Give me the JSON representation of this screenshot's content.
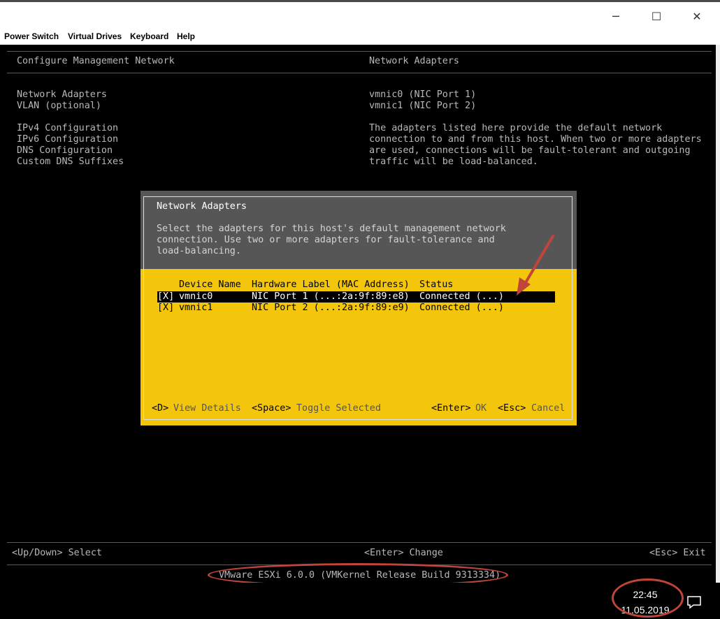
{
  "window": {
    "minimize_icon": "─",
    "maximize_icon": "☐",
    "close_icon": "✕"
  },
  "menu": {
    "items": [
      "Power Switch",
      "Virtual Drives",
      "Keyboard",
      "Help"
    ]
  },
  "console": {
    "left_title": "Configure Management Network",
    "right_title": "Network Adapters",
    "left_menu": [
      "Network Adapters",
      "VLAN (optional)",
      "IPv4 Configuration",
      "IPv6 Configuration",
      "DNS Configuration",
      "Custom DNS Suffixes"
    ],
    "right_adapters": [
      "vmnic0 (NIC Port 1)",
      "vmnic1 (NIC Port 2)"
    ],
    "right_description": [
      "The adapters listed here provide the default network",
      "connection to and from this host. When two or more adapters",
      "are used, connections will be fault-tolerant and outgoing",
      "traffic will be load-balanced."
    ],
    "footer_select": "<Up/Down> Select",
    "footer_change": "<Enter> Change",
    "footer_exit": "<Esc> Exit",
    "version": "VMware ESXi 6.0.0 (VMKernel Release Build 9313334)"
  },
  "dialog": {
    "title": "Network Adapters",
    "description": [
      "Select the adapters for this host's default management network",
      "connection. Use two or more adapters for fault-tolerance and",
      "load-balancing."
    ],
    "columns": {
      "device": "Device Name",
      "hardware": "Hardware Label (MAC Address)",
      "status": "Status"
    },
    "rows": [
      {
        "check": "[X]",
        "device": "vmnic0",
        "hardware": "NIC Port 1 (...:2a:9f:89:e8)",
        "status": "Connected (...)"
      },
      {
        "check": "[X]",
        "device": "vmnic1",
        "hardware": "NIC Port 2 (...:2a:9f:89:e9)",
        "status": "Connected (...)"
      }
    ],
    "keys": {
      "details_key": "<D>",
      "details_label": "View Details",
      "toggle_key": "<Space>",
      "toggle_label": "Toggle Selected",
      "ok_key": "<Enter>",
      "ok_label": "OK",
      "cancel_key": "<Esc>",
      "cancel_label": "Cancel"
    }
  },
  "taskbar": {
    "time": "22:45",
    "date": "11.05.2019",
    "notification_icon": "notification-icon"
  },
  "colors": {
    "dialog_bg": "#f3c50b",
    "dialog_header_bg": "#565656",
    "console_text": "#b8b8b8",
    "annotation": "#c0443a"
  }
}
